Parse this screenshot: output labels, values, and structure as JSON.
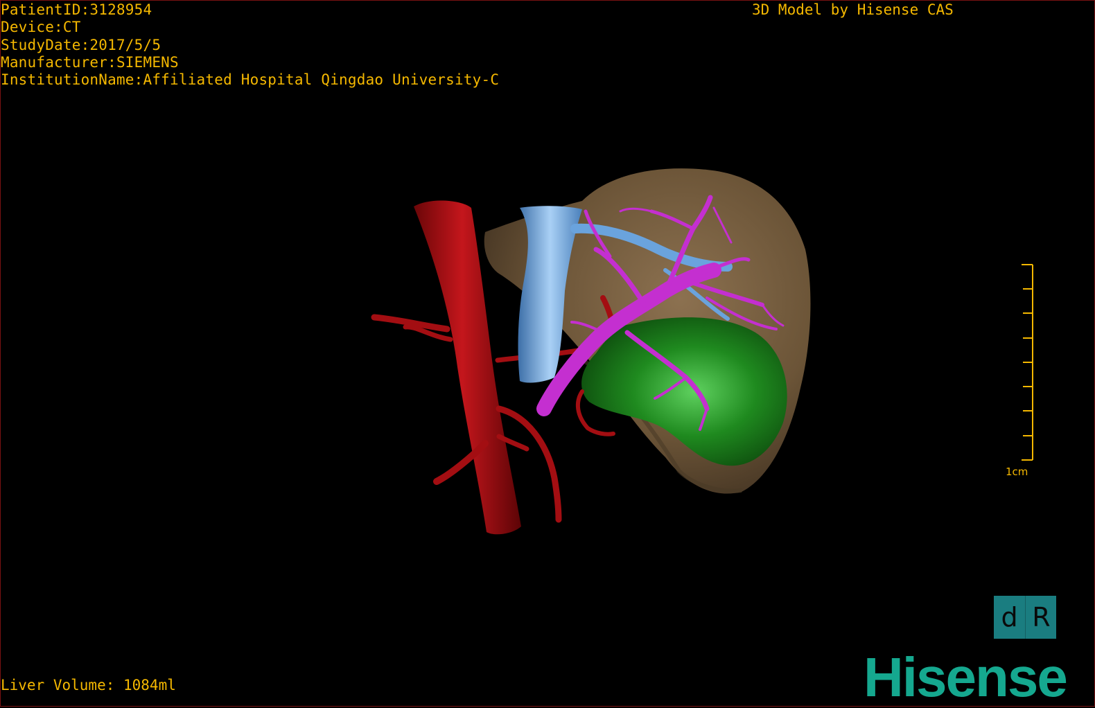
{
  "meta": {
    "patient_id": "PatientID:3128954",
    "device": "Device:CT",
    "study_date": "StudyDate:2017/5/5",
    "manufacturer": "Manufacturer:SIEMENS",
    "institution": "InstitutionName:Affiliated Hospital Qingdao University-C"
  },
  "header": {
    "credit": "3D Model by Hisense CAS"
  },
  "model": {
    "liver_volume": "Liver Volume: 1084ml",
    "scale_label": "1cm",
    "orientation_left": "d",
    "orientation_right": "R",
    "brand": "Hisense",
    "colors": {
      "text": "#f5b800",
      "background": "#000000",
      "liver": "#6b5437",
      "aorta": "#a30e12",
      "vena_cava": "#5f9bd8",
      "portal_vein": "#c42fd0",
      "tumor": "#1f8a1f",
      "orientation_cube": "#1a7d80",
      "brand": "#15a88f"
    }
  }
}
